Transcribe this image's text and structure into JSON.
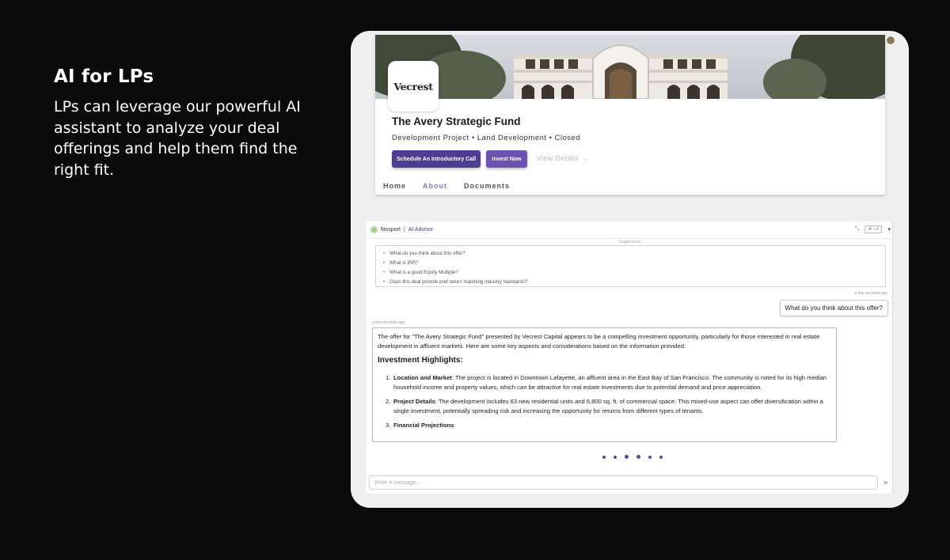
{
  "hero": {
    "title": "AI for LPs",
    "text": "LPs can leverage our powerful AI assistant to analyze your deal offerings and help them find the right fit."
  },
  "fund": {
    "logo": "Vecrest",
    "name": "The Avery Strategic Fund",
    "subtitle": "Development Project • Land Development • Closed",
    "buttons": {
      "call": "Schedule An Introductory Call",
      "invest": "Invest Now",
      "view": "View Details →"
    },
    "tabs": [
      "Home",
      "About",
      "Documents"
    ],
    "active_tab": "About"
  },
  "chat": {
    "brand": "fassport",
    "separator": "|",
    "title": "AI Advisor",
    "shortcut": "⌘ + K",
    "suggestions_label": "Suggestions",
    "suggestions": [
      "What do you think about this offer?",
      "What is IRR?",
      "What is a good Equity Multiple?",
      "Does this deal provide pref return matching industry standards?"
    ],
    "user_timestamp": "a few seconds ago",
    "user_message": "What do you think about this offer?",
    "ai_timestamp": "a few seconds ago",
    "ai_intro": "The offer for \"The Avery Strategic Fund\" presented by Vecrest Capital appears to be a compelling investment opportunity, particularly for those interested in real estate development in affluent markets. Here are some key aspects and considerations based on the information provided:",
    "ai_heading": "Investment Highlights:",
    "ai_points": [
      {
        "num": "1.",
        "title": "Location and Market",
        "text": ": The project is located in Downtown Lafayette, an affluent area in the East Bay of San Francisco. The community is noted for its high median household income and property values, which can be attractive for real estate investments due to potential demand and price appreciation."
      },
      {
        "num": "2.",
        "title": "Project Details",
        "text": ": The development includes 63 new residential units and 6,800 sq. ft. of commercial space. This mixed-use aspect can offer diversification within a single investment, potentially spreading risk and increasing the opportunity for returns from different types of tenants."
      },
      {
        "num": "3.",
        "title": "Financial Projections",
        "text": ":"
      }
    ],
    "input_placeholder": "Write a message..."
  },
  "colors": {
    "accent": "#4f3c93",
    "accent_light": "#6c52b3",
    "background": "#0b0b0b"
  }
}
